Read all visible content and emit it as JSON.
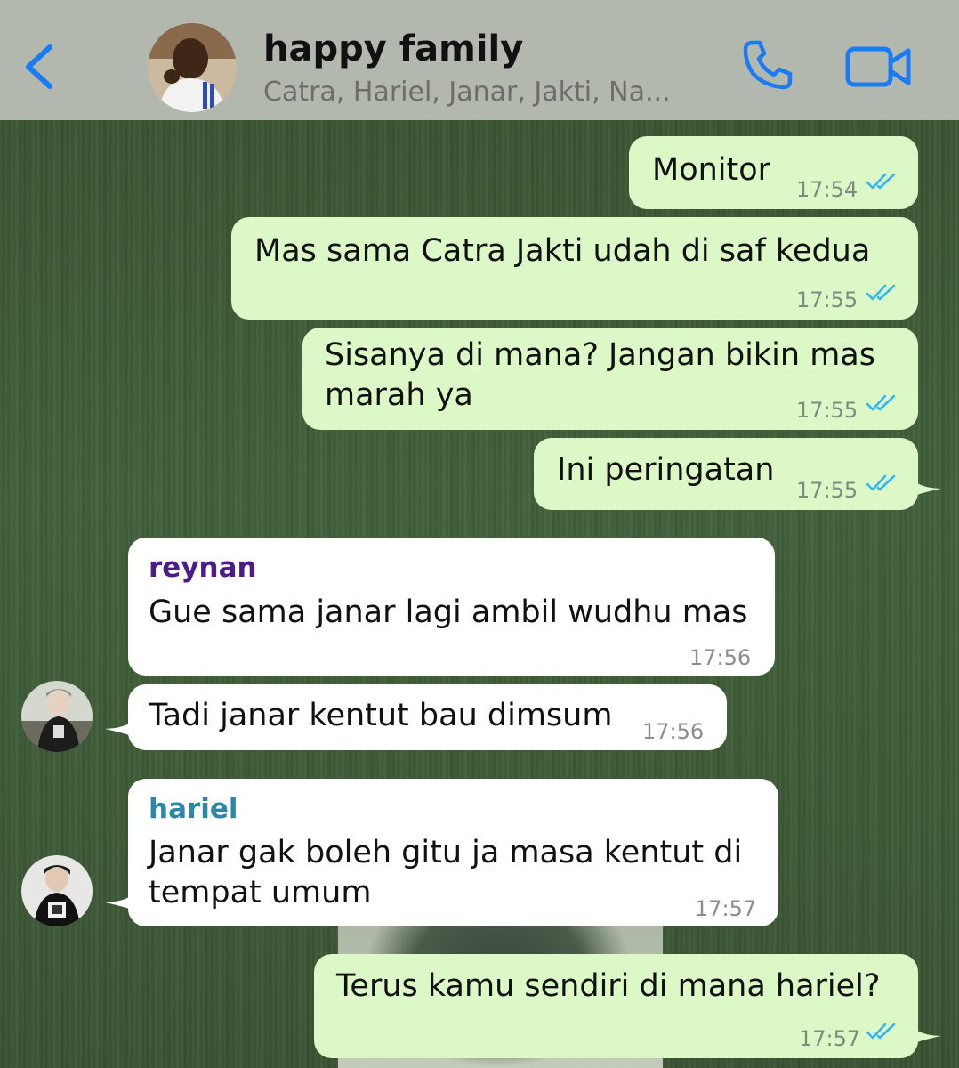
{
  "header": {
    "title": "happy family",
    "members": "Catra, Hariel, Janar, Jakti, Na..."
  },
  "colors": {
    "outgoing_bubble": "#dcf8c6",
    "incoming_bubble": "#ffffff",
    "accent": "#1a7cf5",
    "read_ticks": "#34b7f1",
    "sender_reynan": "#4b1c8a",
    "sender_hariel": "#2b86a8"
  },
  "messages": [
    {
      "direction": "out",
      "text": "Monitor",
      "time": "17:54",
      "status": "read"
    },
    {
      "direction": "out",
      "text": "Mas sama Catra Jakti udah di saf kedua",
      "time": "17:55",
      "status": "read"
    },
    {
      "direction": "out",
      "lines": [
        "Sisanya di mana? Jangan bikin mas",
        "marah ya"
      ],
      "time": "17:55",
      "status": "read"
    },
    {
      "direction": "out",
      "text": "Ini peringatan",
      "time": "17:55",
      "status": "read"
    },
    {
      "direction": "in",
      "sender": "reynan",
      "text": "Gue sama janar lagi ambil wudhu mas",
      "time": "17:56"
    },
    {
      "direction": "in",
      "text": "Tadi janar kentut bau dimsum",
      "time": "17:56"
    },
    {
      "direction": "in",
      "sender": "hariel",
      "lines": [
        "Janar gak boleh gitu ja masa kentut di",
        "tempat umum"
      ],
      "time": "17:57"
    },
    {
      "direction": "out",
      "text": "Terus kamu sendiri di mana hariel?",
      "time": "17:57",
      "status": "read"
    }
  ]
}
